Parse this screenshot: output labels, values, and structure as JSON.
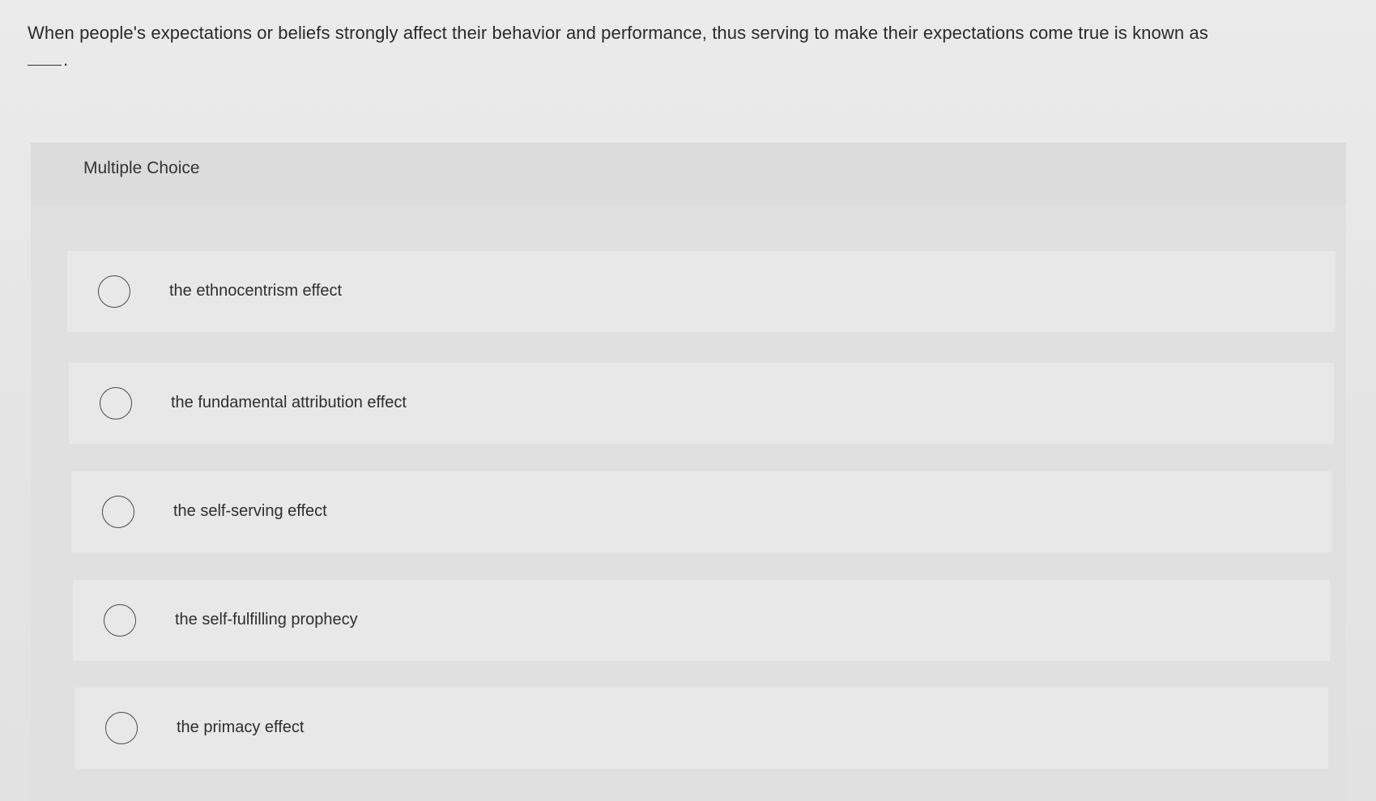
{
  "question": {
    "text": "When people's expectations or beliefs strongly affect their behavior and performance, thus serving to make their expectations come true is known as",
    "end_punct": "."
  },
  "panel": {
    "title": "Multiple Choice"
  },
  "options": [
    {
      "label": "the ethnocentrism effect"
    },
    {
      "label": "the fundamental attribution effect"
    },
    {
      "label": "the self-serving effect"
    },
    {
      "label": "the self-fulfilling prophecy"
    },
    {
      "label": "the primacy effect"
    }
  ]
}
